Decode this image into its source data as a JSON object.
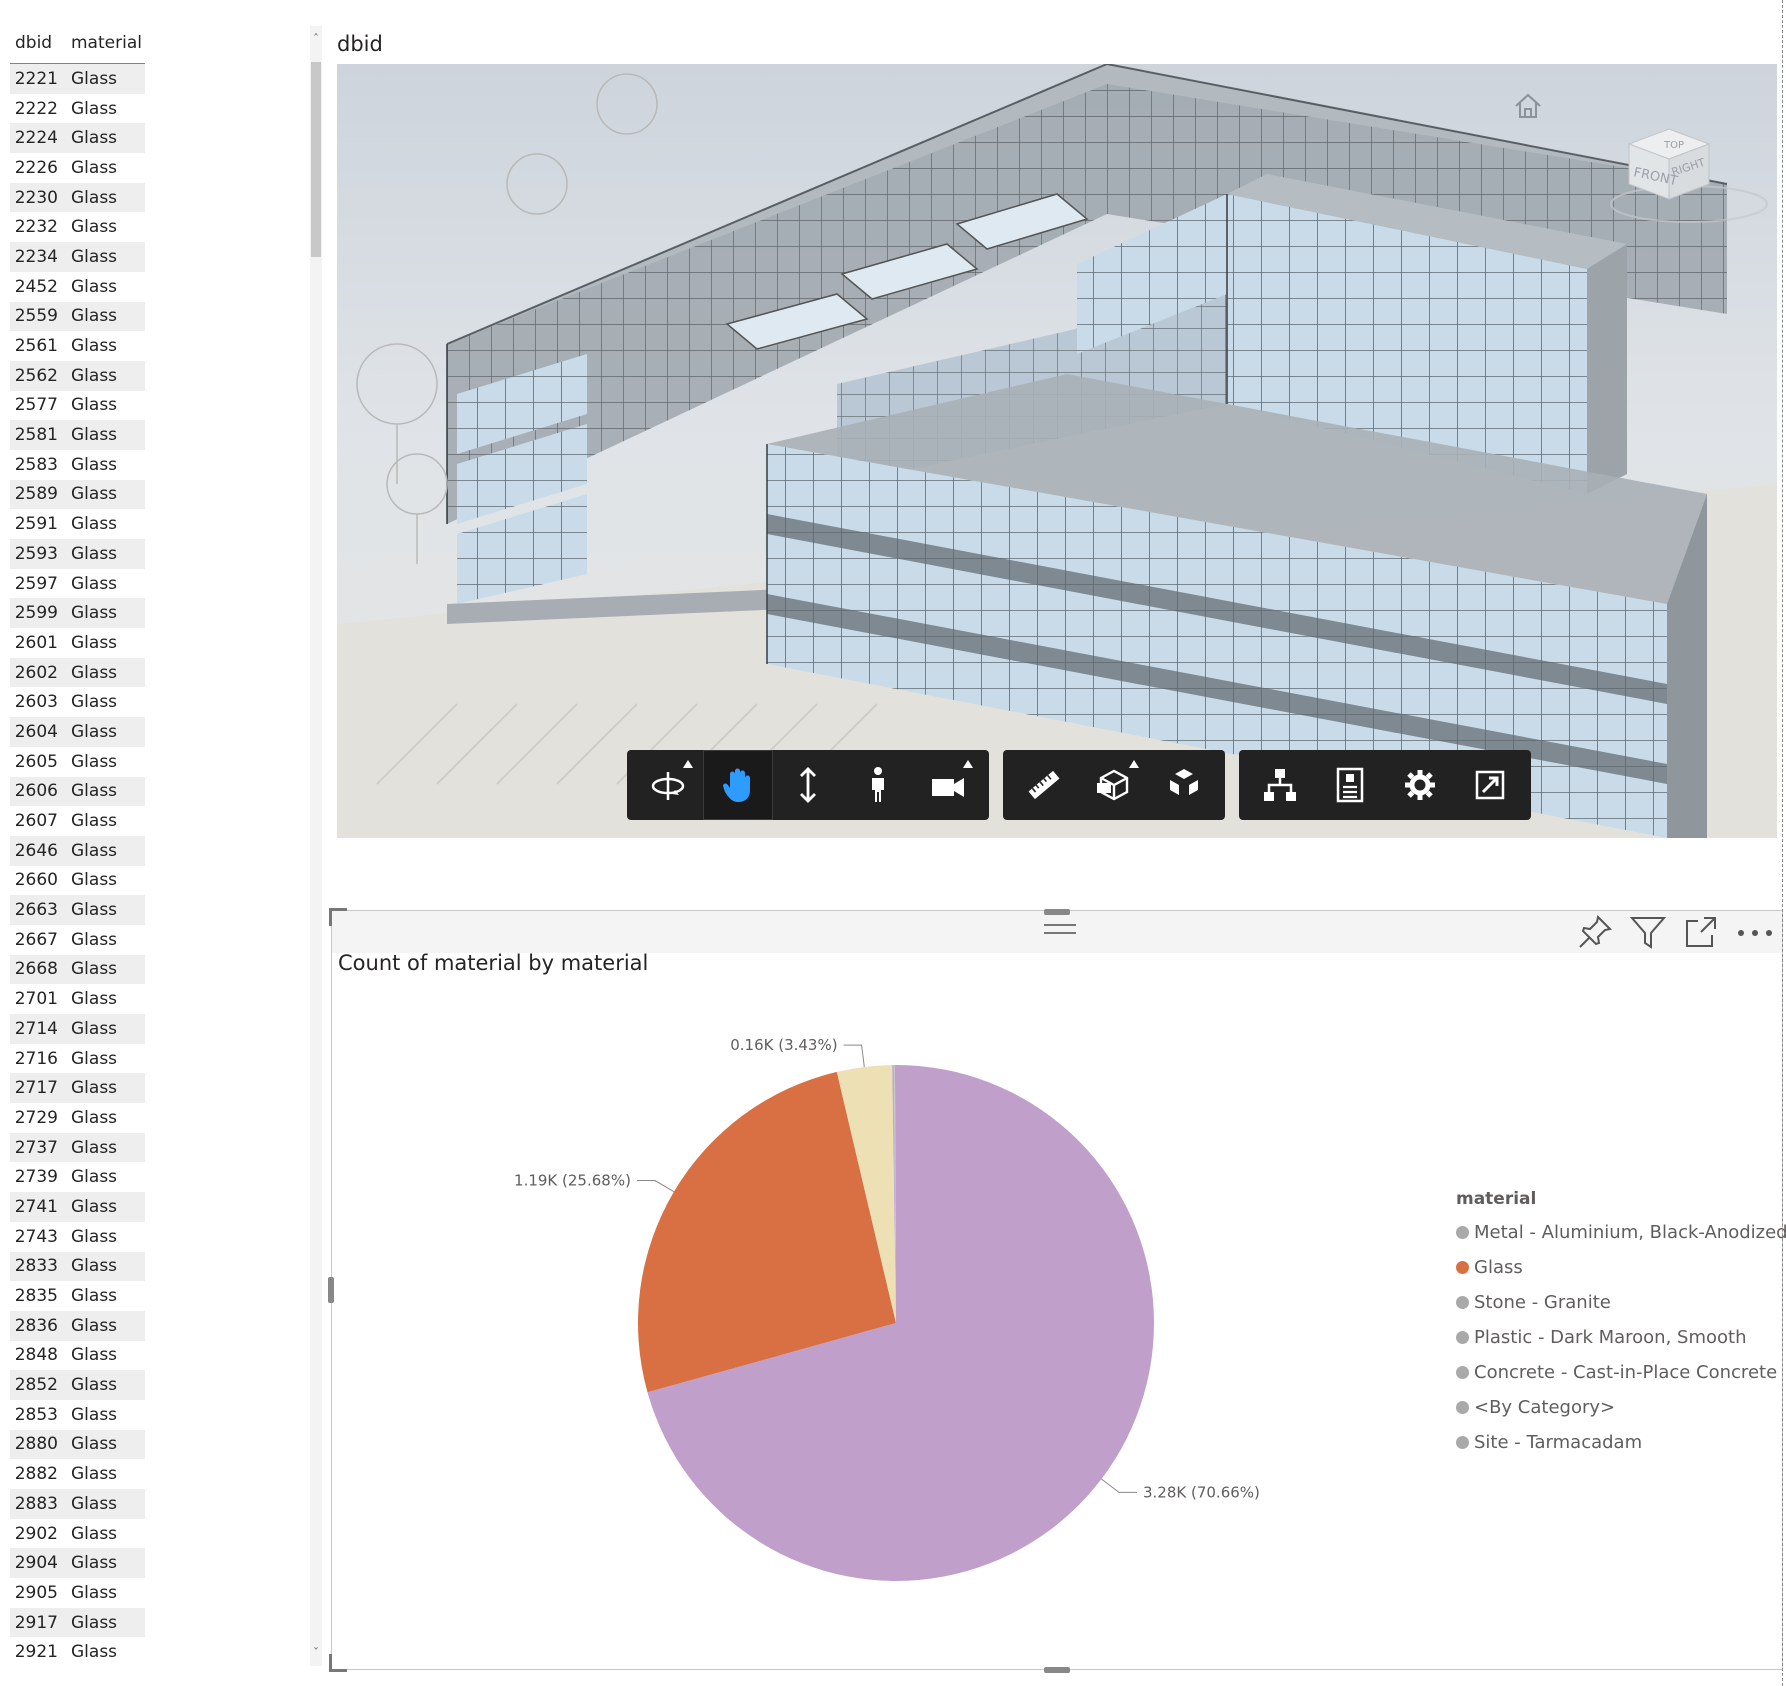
{
  "table": {
    "headers": [
      "dbid",
      "material"
    ],
    "rows": [
      [
        "2221",
        "Glass"
      ],
      [
        "2222",
        "Glass"
      ],
      [
        "2224",
        "Glass"
      ],
      [
        "2226",
        "Glass"
      ],
      [
        "2230",
        "Glass"
      ],
      [
        "2232",
        "Glass"
      ],
      [
        "2234",
        "Glass"
      ],
      [
        "2452",
        "Glass"
      ],
      [
        "2559",
        "Glass"
      ],
      [
        "2561",
        "Glass"
      ],
      [
        "2562",
        "Glass"
      ],
      [
        "2577",
        "Glass"
      ],
      [
        "2581",
        "Glass"
      ],
      [
        "2583",
        "Glass"
      ],
      [
        "2589",
        "Glass"
      ],
      [
        "2591",
        "Glass"
      ],
      [
        "2593",
        "Glass"
      ],
      [
        "2597",
        "Glass"
      ],
      [
        "2599",
        "Glass"
      ],
      [
        "2601",
        "Glass"
      ],
      [
        "2602",
        "Glass"
      ],
      [
        "2603",
        "Glass"
      ],
      [
        "2604",
        "Glass"
      ],
      [
        "2605",
        "Glass"
      ],
      [
        "2606",
        "Glass"
      ],
      [
        "2607",
        "Glass"
      ],
      [
        "2646",
        "Glass"
      ],
      [
        "2660",
        "Glass"
      ],
      [
        "2663",
        "Glass"
      ],
      [
        "2667",
        "Glass"
      ],
      [
        "2668",
        "Glass"
      ],
      [
        "2701",
        "Glass"
      ],
      [
        "2714",
        "Glass"
      ],
      [
        "2716",
        "Glass"
      ],
      [
        "2717",
        "Glass"
      ],
      [
        "2729",
        "Glass"
      ],
      [
        "2737",
        "Glass"
      ],
      [
        "2739",
        "Glass"
      ],
      [
        "2741",
        "Glass"
      ],
      [
        "2743",
        "Glass"
      ],
      [
        "2833",
        "Glass"
      ],
      [
        "2835",
        "Glass"
      ],
      [
        "2836",
        "Glass"
      ],
      [
        "2848",
        "Glass"
      ],
      [
        "2852",
        "Glass"
      ],
      [
        "2853",
        "Glass"
      ],
      [
        "2880",
        "Glass"
      ],
      [
        "2882",
        "Glass"
      ],
      [
        "2883",
        "Glass"
      ],
      [
        "2902",
        "Glass"
      ],
      [
        "2904",
        "Glass"
      ],
      [
        "2905",
        "Glass"
      ],
      [
        "2917",
        "Glass"
      ],
      [
        "2921",
        "Glass"
      ]
    ]
  },
  "viewer": {
    "title": "dbid",
    "viewcube_labels": [
      "TOP",
      "FRONT",
      "RIGHT"
    ],
    "toolbar": [
      [
        "orbit-icon",
        "pan-icon",
        "zoom-icon",
        "first-person-icon",
        "camera-icon"
      ],
      [
        "measure-icon",
        "section-icon",
        "explode-icon"
      ],
      [
        "model-browser-icon",
        "properties-icon",
        "settings-icon",
        "fullscreen-icon"
      ]
    ],
    "active_tool": "pan-icon",
    "accent": "#2e9cff"
  },
  "visual_header_icons": [
    "pin-icon",
    "filter-icon",
    "focus-mode-icon",
    "more-options-icon"
  ],
  "chart_data": {
    "type": "pie",
    "title": "Count of material by material",
    "legend_title": "material",
    "legend_position": "right",
    "series": [
      {
        "name": "Metal - Aluminium, Black-Anodized",
        "value": 3280,
        "percent": 70.66,
        "label": "3.28K (70.66%)",
        "color": "#c0a0ca",
        "legend_color": "#a9a9a9"
      },
      {
        "name": "Glass",
        "value": 1190,
        "percent": 25.68,
        "label": "1.19K (25.68%)",
        "color": "#d87043",
        "legend_color": "#d87043"
      },
      {
        "name": "Stone - Granite",
        "value": 160,
        "percent": 3.43,
        "label": "0.16K (3.43%)",
        "color": "#ede0b4",
        "legend_color": "#a9a9a9"
      },
      {
        "name": "Plastic - Dark Maroon, Smooth",
        "value": 5,
        "percent": 0.1,
        "label": "",
        "color": "#b9aad3",
        "legend_color": "#a9a9a9"
      },
      {
        "name": "Concrete - Cast-in-Place Concrete",
        "value": 3,
        "percent": 0.07,
        "label": "",
        "color": "#c9c6c0",
        "legend_color": "#a9a9a9"
      },
      {
        "name": "<By Category>",
        "value": 2,
        "percent": 0.04,
        "label": "",
        "color": "#a9a9a9",
        "legend_color": "#a9a9a9"
      },
      {
        "name": "Site - Tarmacadam",
        "value": 1,
        "percent": 0.02,
        "label": "",
        "color": "#9a9a9a",
        "legend_color": "#a9a9a9"
      }
    ]
  }
}
